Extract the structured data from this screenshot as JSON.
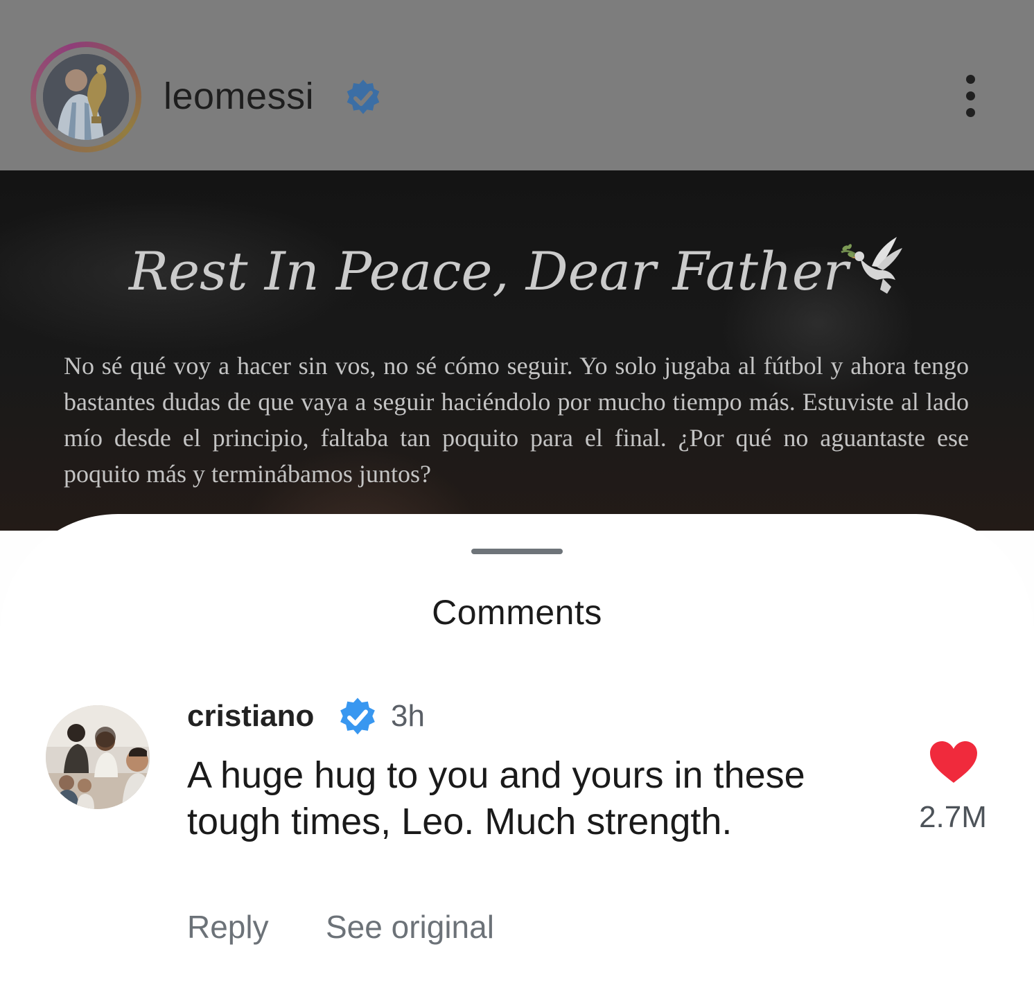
{
  "post": {
    "author": "leomessi",
    "author_verified": true,
    "icons": {
      "verified": "verified-badge-icon",
      "menu": "more-options-icon",
      "dove": "dove-icon"
    },
    "image": {
      "title": "Rest In Peace, Dear Father",
      "body": "No sé qué voy a hacer sin vos, no sé cómo seguir. Yo solo jugaba al fútbol y ahora tengo bastantes dudas de que vaya a seguir haciéndolo por mucho tiempo más. Estuviste al lado mío desde el principio, faltaba tan poquito para el final. ¿Por qué no aguantaste ese poquito más y terminábamos juntos?"
    }
  },
  "comments_sheet": {
    "title": "Comments",
    "comments": [
      {
        "author": "cristiano",
        "verified": true,
        "time": "3h",
        "text": "A huge hug to you and yours in these tough times, Leo. Much strength.",
        "likes": "2.7M",
        "liked": true,
        "reply_label": "Reply",
        "see_original_label": "See original"
      }
    ]
  },
  "colors": {
    "verified_badge": "#3897f0",
    "like_heart": "#f02a3c",
    "header_background": "#7d7d7d",
    "sheet_background": "#ffffff"
  }
}
